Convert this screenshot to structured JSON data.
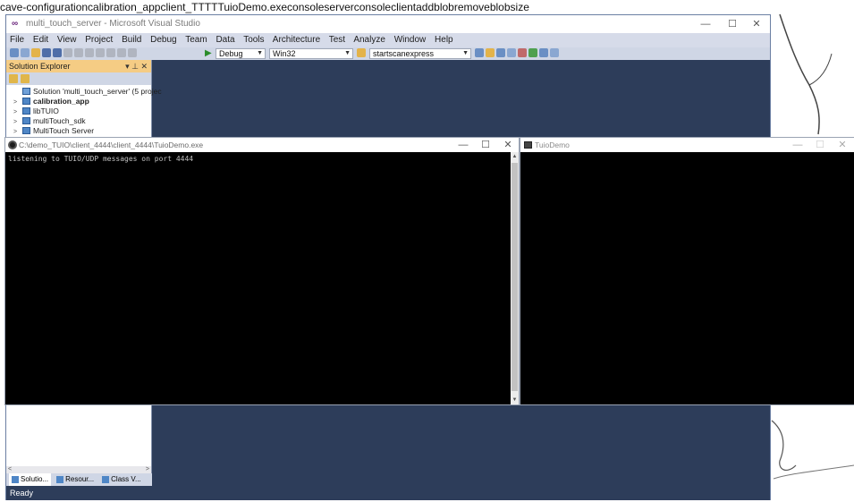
{
  "stray_text": "cave-configurationcalibration_appclient_TTTTTuioDemo.execonsoleserverconsoleclientaddblobremoveblobsize",
  "vs": {
    "title": "multi_touch_server - Microsoft Visual Studio",
    "window_controls": [
      "—",
      "☐",
      "✕"
    ],
    "menu": [
      "File",
      "Edit",
      "View",
      "Project",
      "Build",
      "Debug",
      "Team",
      "Data",
      "Tools",
      "Architecture",
      "Test",
      "Analyze",
      "Window",
      "Help"
    ],
    "toolbar": {
      "config": "Debug",
      "platform": "Win32",
      "startup": "startscanexpress"
    },
    "solution_explorer": {
      "title": "Solution Explorer",
      "controls": "▾ ⊥ ✕",
      "items": [
        {
          "label": "Solution 'multi_touch_server' (5 projec",
          "bold": false,
          "expander": ""
        },
        {
          "label": "calibration_app",
          "bold": true,
          "expander": ">"
        },
        {
          "label": "libTUIO",
          "bold": false,
          "expander": ">"
        },
        {
          "label": "multiTouch_sdk",
          "bold": false,
          "expander": ">"
        },
        {
          "label": "MultiTouch Server",
          "bold": false,
          "expander": ">"
        }
      ],
      "bottom_tabs": [
        "Solutio...",
        "Resour...",
        "Class V..."
      ]
    },
    "status": "Ready"
  },
  "console": {
    "title": "C:\\demo_TUIO\\client_4444\\client_4444\\TuioDemo.exe",
    "window_controls": [
      "—",
      "☐",
      "✕"
    ],
    "output": "listening to TUIO/UDP messages on port 4444"
  },
  "tuio": {
    "title": "TuioDemo",
    "window_controls": [
      "—",
      "☐",
      "✕"
    ]
  },
  "colors": {
    "vs_background": "#2d3d5a",
    "solution_header": "#f5cc84",
    "console_bg": "#000000"
  }
}
